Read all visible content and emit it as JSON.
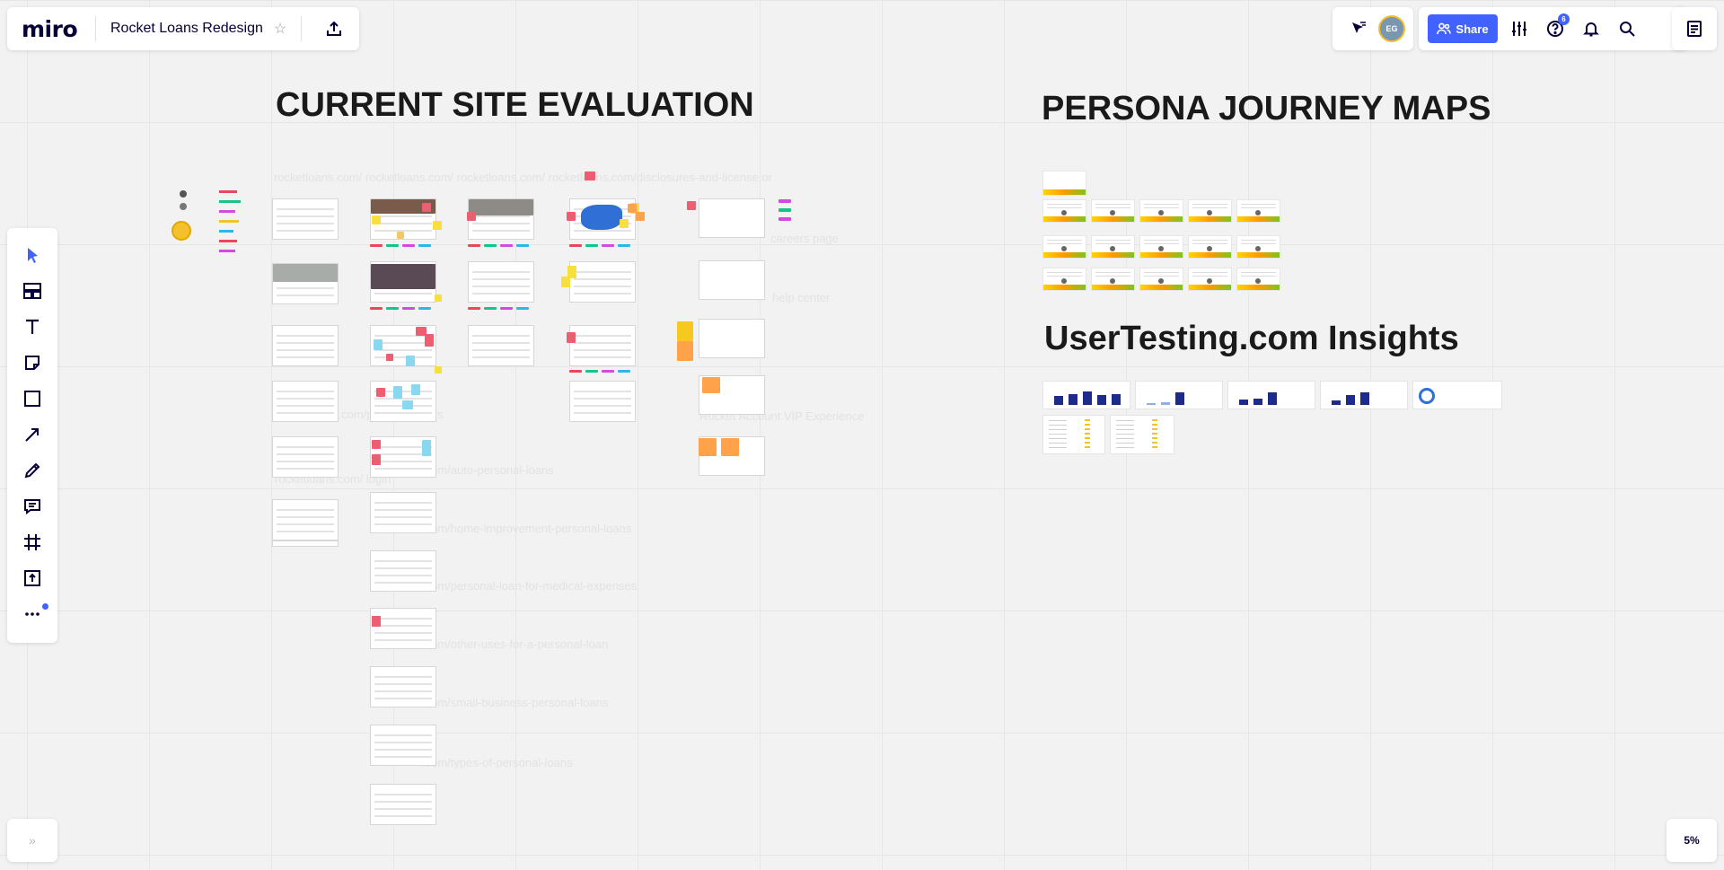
{
  "app": {
    "logo": "miro",
    "board_title": "Rocket Loans Redesign",
    "share_label": "Share",
    "help_badge": "6",
    "zoom": "5%",
    "avatar_initials": "EG",
    "accent_color": "#4262ff"
  },
  "icons": {
    "star": "star-icon",
    "export": "upload-icon",
    "cursor_follow": "cursor-icon",
    "share": "users-icon",
    "settings": "sliders-icon",
    "help": "help-icon",
    "notifications": "bell-icon",
    "search": "search-icon",
    "notes": "notes-icon",
    "expand": "chevrons-right-icon"
  },
  "toolbar": {
    "tools": [
      {
        "name": "select-tool",
        "icon": "cursor-icon"
      },
      {
        "name": "templates-tool",
        "icon": "templates-icon"
      },
      {
        "name": "text-tool",
        "icon": "text-icon"
      },
      {
        "name": "sticky-note-tool",
        "icon": "sticky-note-icon"
      },
      {
        "name": "shape-tool",
        "icon": "square-icon"
      },
      {
        "name": "connection-line-tool",
        "icon": "arrow-icon"
      },
      {
        "name": "pen-tool",
        "icon": "pen-icon"
      },
      {
        "name": "comment-tool",
        "icon": "comment-icon"
      },
      {
        "name": "frame-tool",
        "icon": "frame-icon"
      },
      {
        "name": "upload-tool",
        "icon": "upload-icon"
      },
      {
        "name": "more-tools",
        "icon": "more-icon"
      }
    ]
  },
  "canvas": {
    "headings": {
      "current": "CURRENT SITE EVALUATION",
      "persona": "PERSONA JOURNEY MAPS",
      "insights": "UserTesting.com Insights"
    },
    "faint_labels": {
      "row1": "rocketloans.com/   rocketloans.com/   rocketloans.com/   rocketloans.com/disclosures-and-license   or",
      "row2": "careers page",
      "row3": "help center",
      "row4": "rocketloans.com/personal-loans",
      "row5": "Rocket Account VIP Experience",
      "row6": "rocketloans.com/ login",
      "row7": ".com/auto-personal-loans",
      "row8": ".com/home-improvement-personal-loans",
      "row9": ".com/personal-loan-for-medical-expenses",
      "row10": ".com/other-uses-for-a-personal-loan",
      "row11": ".com/small-business-personal-loans",
      "row12": ".com/types-of-personal-loans"
    }
  }
}
